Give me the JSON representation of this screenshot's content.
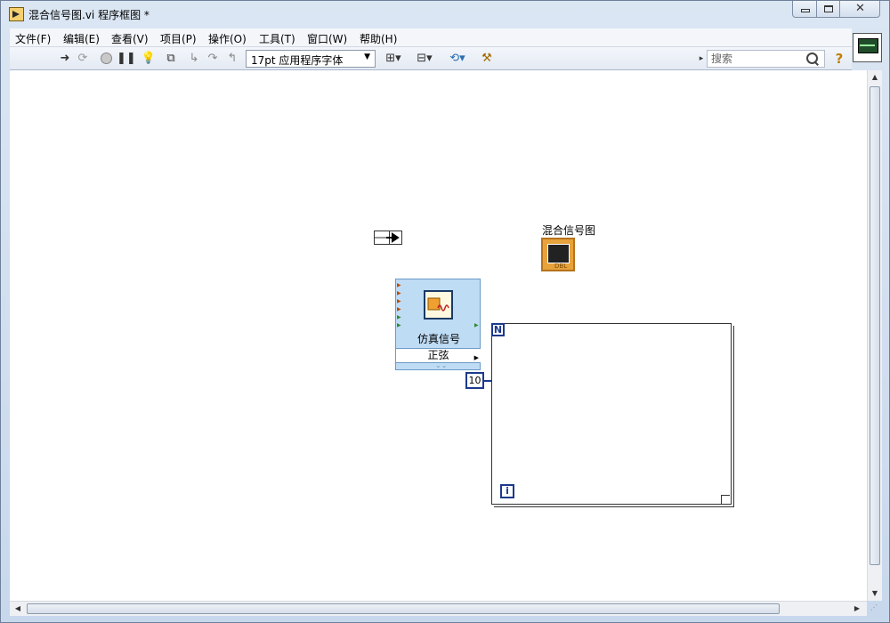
{
  "window": {
    "title": "混合信号图.vi 程序框图 *",
    "controls": {
      "minimize": "minimize",
      "maximize": "maximize",
      "close": "✕"
    }
  },
  "menu": [
    {
      "label": "文件(F)"
    },
    {
      "label": "编辑(E)"
    },
    {
      "label": "查看(V)"
    },
    {
      "label": "项目(P)"
    },
    {
      "label": "操作(O)"
    },
    {
      "label": "工具(T)"
    },
    {
      "label": "窗口(W)"
    },
    {
      "label": "帮助(H)"
    }
  ],
  "toolbar": {
    "icons": [
      "run-arrow-icon",
      "run-continuously-icon",
      "abort-icon",
      "pause-icon",
      "highlight-execution-icon",
      "retain-wire-values-icon",
      "step-into-icon",
      "step-over-icon",
      "step-out-icon"
    ],
    "font_select": "17pt 应用程序字体",
    "search_placeholder": "搜索",
    "help": "?"
  },
  "diagram": {
    "graph_label": "混合信号图",
    "graph_terminal_type": "DBL",
    "express_vi": {
      "title": "仿真信号",
      "mode": "正弦"
    },
    "for_loop": {
      "count_terminal": "N",
      "iteration_terminal": "i",
      "count_constant": "10"
    }
  },
  "colors": {
    "loop_border": "#333333",
    "terminal_blue": "#1c3a8c",
    "express_vi_bg": "#bfdcf5",
    "graph_terminal": "#e8a23b"
  }
}
